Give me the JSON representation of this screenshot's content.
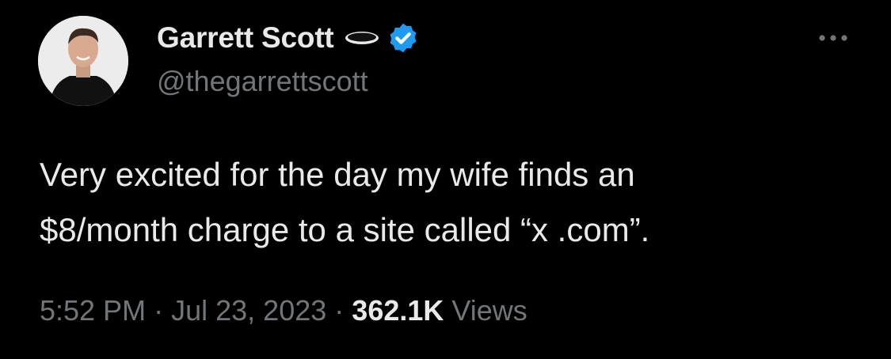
{
  "tweet": {
    "author": {
      "display_name": "Garrett Scott",
      "handle": "@thegarrettscott",
      "avatar_icon": "avatar-photo",
      "affiliation_icon": "black-oval-badge-icon",
      "verified_icon": "verified-badge-icon",
      "verified_color": "#1d9bf0"
    },
    "more_icon": "more-horizontal-icon",
    "text": "Very excited for the day my wife finds an\n$8/month charge to a site called “x .com”.",
    "timestamp": "5:52 PM",
    "separator": "·",
    "date": "Jul 23, 2023",
    "views_count": "362.1K",
    "views_label": "Views"
  },
  "colors": {
    "background": "#000000",
    "primary_text": "#e7e9ea",
    "secondary_text": "#71767b",
    "accent": "#1d9bf0"
  }
}
